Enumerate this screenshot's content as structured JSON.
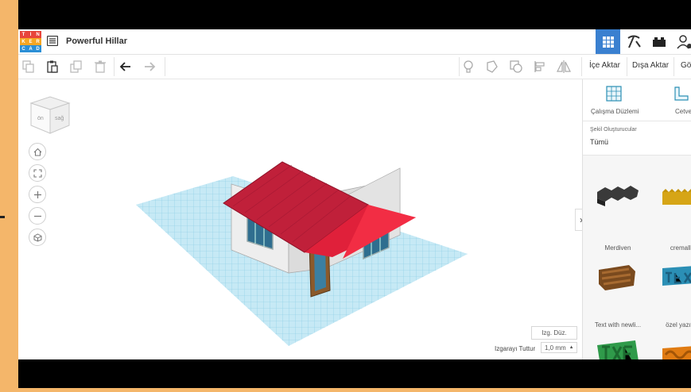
{
  "app": {
    "logo_letters": [
      "T",
      "I",
      "N",
      "K",
      "E",
      "R",
      "C",
      "A",
      "D"
    ],
    "logo_colors": [
      "#e8453c",
      "#e8453c",
      "#e8453c",
      "#f5a623",
      "#f5a623",
      "#f5a623",
      "#2b8fd6",
      "#2b8fd6",
      "#2b8fd6"
    ],
    "project_title": "Powerful Hillar"
  },
  "toolbar": {
    "import_label": "İçe Aktar",
    "export_label": "Dışa Aktar",
    "send_label": "Gö"
  },
  "viewcube": {
    "front_label": "ön",
    "side_label": "sağ"
  },
  "panel": {
    "workplane_label": "Çalışma Düzlemi",
    "ruler_label": "Cetve",
    "generators_title": "Şekil Oluşturucular",
    "generators_value": "Tümü",
    "shapes": [
      {
        "label": "Merdiven"
      },
      {
        "label": "cremalle"
      },
      {
        "label": "Text with newli..."
      },
      {
        "label": "özel yazıtipl"
      }
    ]
  },
  "workplane": {
    "edit_grid_label": "Izg. Düz.",
    "snap_grid_label": "Izgarayı Tuttur",
    "snap_grid_value": "1,0 mm"
  },
  "colors": {
    "accent": "#3a80d0",
    "roof": "#c0203a",
    "grid": "#a9dcee"
  }
}
